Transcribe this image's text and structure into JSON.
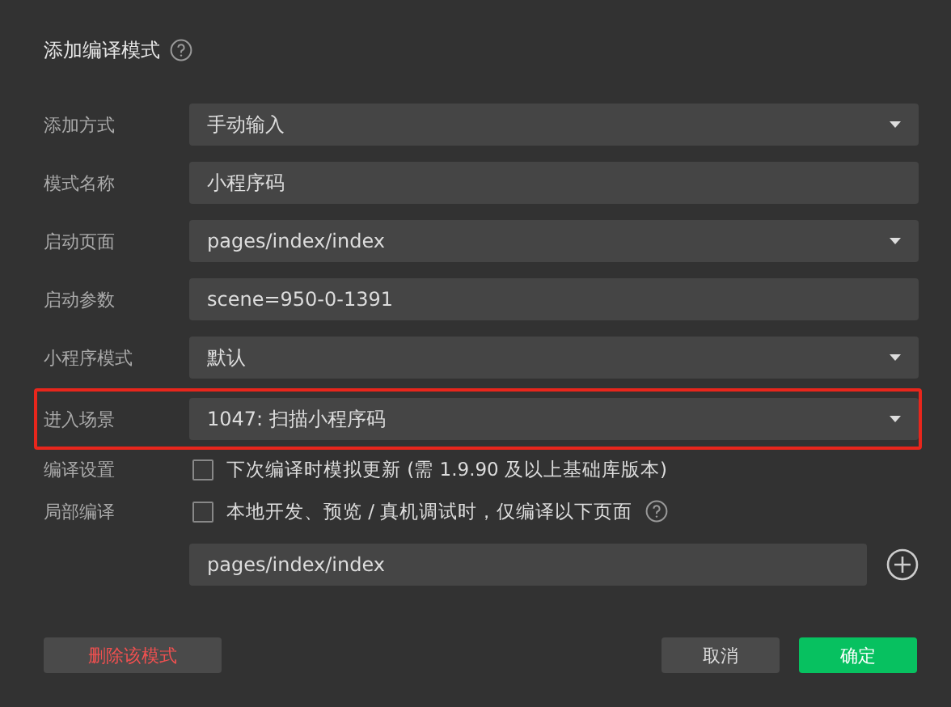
{
  "dialog": {
    "title": "添加编译模式"
  },
  "fields": [
    {
      "label": "添加方式",
      "kind": "select",
      "value": "手动输入",
      "highlighted": false
    },
    {
      "label": "模式名称",
      "kind": "text",
      "value": "小程序码",
      "highlighted": false
    },
    {
      "label": "启动页面",
      "kind": "select",
      "value": "pages/index/index",
      "highlighted": false
    },
    {
      "label": "启动参数",
      "kind": "text",
      "value": "scene=950-0-1391",
      "highlighted": false
    },
    {
      "label": "小程序模式",
      "kind": "select",
      "value": "默认",
      "highlighted": false
    },
    {
      "label": "进入场景",
      "kind": "select",
      "value": "1047: 扫描小程序码",
      "highlighted": true
    },
    {
      "label": "编译设置",
      "kind": "checkbox",
      "value": "下次编译时模拟更新 (需 1.9.90 及以上基础库版本)",
      "checked": false,
      "help": false
    },
    {
      "label": "局部编译",
      "kind": "checkbox",
      "value": "本地开发、预览 / 真机调试时，仅编译以下页面",
      "checked": false,
      "help": true
    },
    {
      "kind": "page",
      "value": "pages/index/index"
    }
  ],
  "buttons": {
    "delete": "删除该模式",
    "cancel": "取消",
    "confirm": "确定"
  }
}
